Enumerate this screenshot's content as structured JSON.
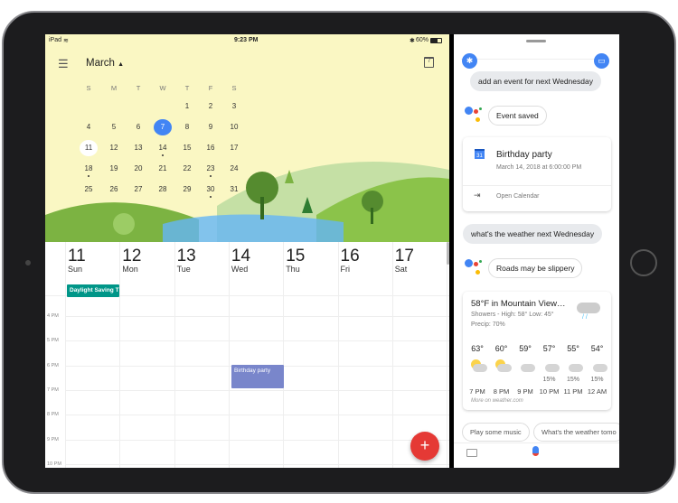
{
  "status": {
    "device": "iPad",
    "time": "9:23 PM",
    "battery": "60%"
  },
  "calendar": {
    "month": "March",
    "today_icon": "7",
    "weekdays": [
      "S",
      "M",
      "T",
      "W",
      "T",
      "F",
      "S"
    ],
    "weeks": [
      [
        "",
        "",
        "",
        "",
        "1",
        "2",
        "3"
      ],
      [
        "4",
        "5",
        "6",
        "7",
        "8",
        "9",
        "10"
      ],
      [
        "11",
        "12",
        "13",
        "14",
        "15",
        "16",
        "17"
      ],
      [
        "18",
        "19",
        "20",
        "21",
        "22",
        "23",
        "24"
      ],
      [
        "25",
        "26",
        "27",
        "28",
        "29",
        "30",
        "31"
      ]
    ],
    "today": "7",
    "selected": "11",
    "event_dots": [
      "14",
      "18",
      "23",
      "30"
    ],
    "week": [
      {
        "n": "11",
        "d": "Sun"
      },
      {
        "n": "12",
        "d": "Mon"
      },
      {
        "n": "13",
        "d": "Tue"
      },
      {
        "n": "14",
        "d": "Wed"
      },
      {
        "n": "15",
        "d": "Thu"
      },
      {
        "n": "16",
        "d": "Fri"
      },
      {
        "n": "17",
        "d": "Sat"
      }
    ],
    "allday_event": "Daylight Saving T",
    "hours": [
      "4 PM",
      "5 PM",
      "6 PM",
      "7 PM",
      "8 PM",
      "9 PM",
      "10 PM"
    ],
    "event": {
      "title": "Birthday party",
      "color": "#7986cb"
    },
    "fab": "+",
    "accent": "#4285f4",
    "fab_color": "#e53935"
  },
  "assistant": {
    "user_query_1": "add an event for next Wednesday",
    "reply_1": "Event saved",
    "event_card": {
      "title": "Birthday party",
      "datetime": "March 14, 2018 at 6:00:00 PM",
      "icon_day": "31",
      "action": "Open Calendar"
    },
    "user_query_2": "what's the weather next Wednesday",
    "reply_2": "Roads may be slippery",
    "weather": {
      "title": "58°F in Mountain View…",
      "summary": "Showers - High: 58° Low: 45°",
      "precip": "Precip: 70%",
      "hourly": [
        {
          "t": "63°",
          "icon": "partly-sunny",
          "p": "",
          "h": "7 PM"
        },
        {
          "t": "60°",
          "icon": "partly-sunny",
          "p": "",
          "h": "8 PM"
        },
        {
          "t": "59°",
          "icon": "cloudy",
          "p": "",
          "h": "9 PM"
        },
        {
          "t": "57°",
          "icon": "cloudy",
          "p": "15%",
          "h": "10 PM"
        },
        {
          "t": "55°",
          "icon": "cloudy",
          "p": "15%",
          "h": "11 PM"
        },
        {
          "t": "54°",
          "icon": "cloudy",
          "p": "15%",
          "h": "12 AM"
        }
      ],
      "source": "More on weather.com"
    },
    "suggestions": [
      "Play some music",
      "What's the weather tomo"
    ]
  }
}
